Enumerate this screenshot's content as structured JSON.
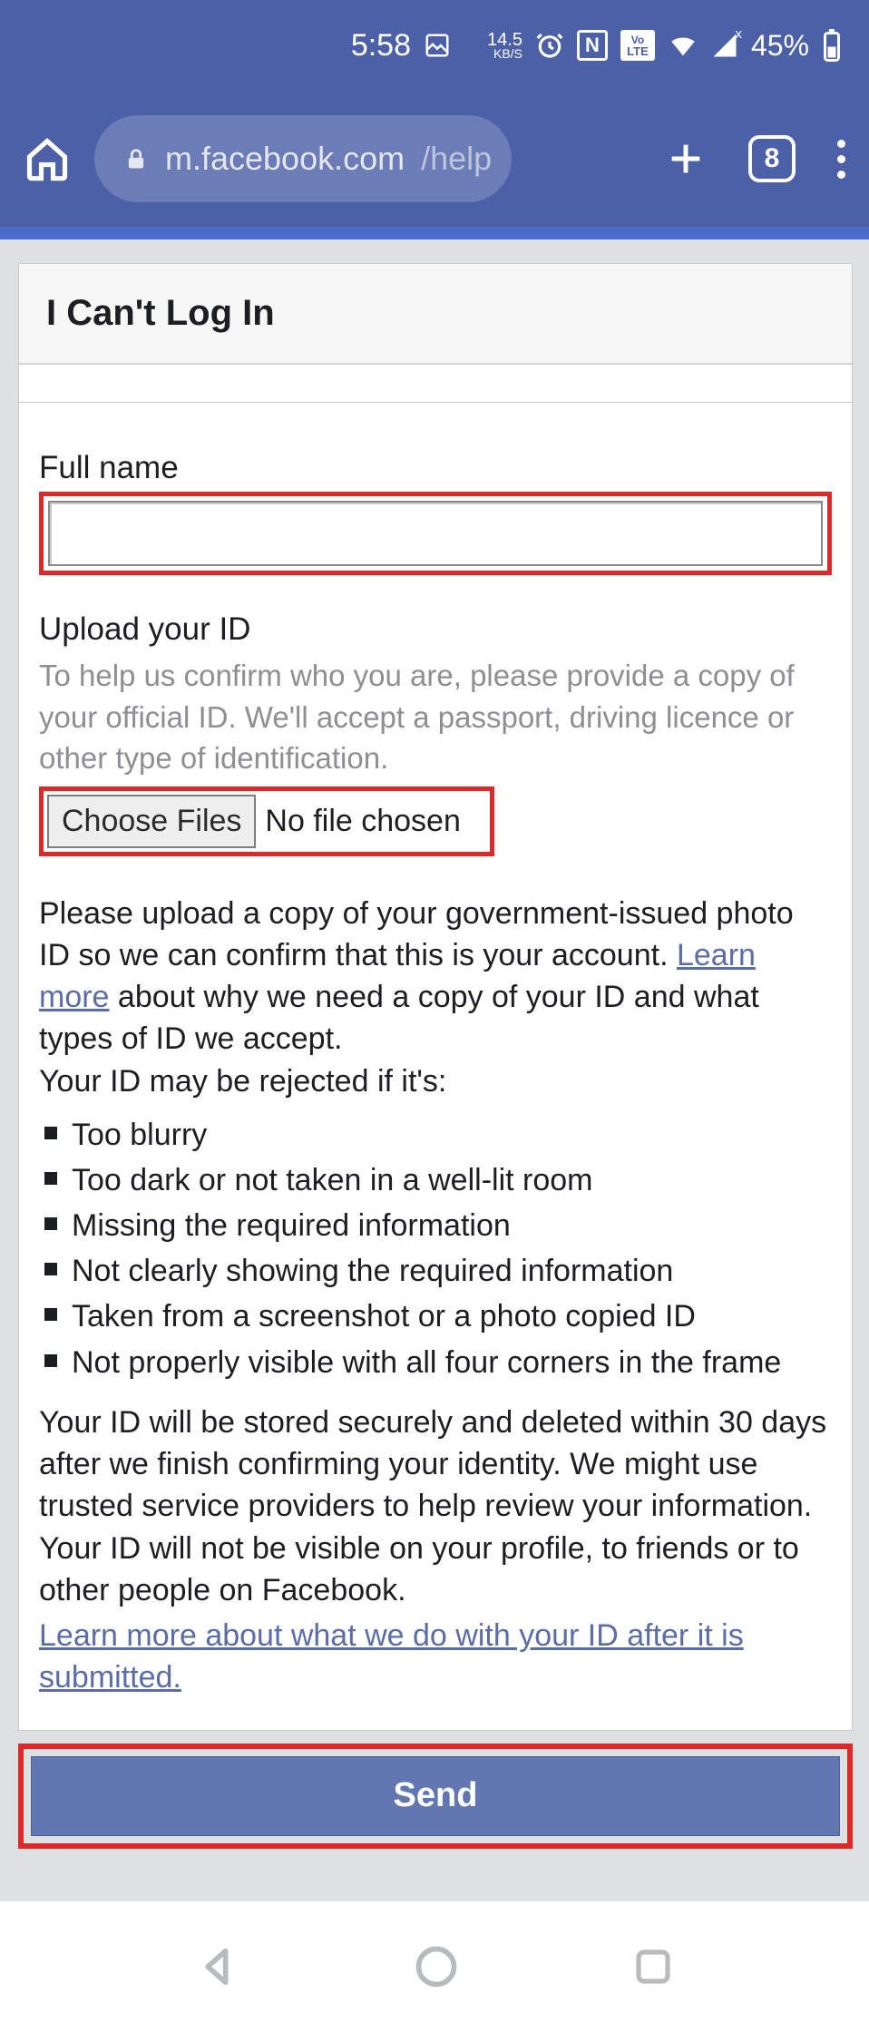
{
  "status": {
    "time": "5:58",
    "speed_top": "14.5",
    "speed_bottom": "KB/S",
    "network_badge": "Vo\nLTE",
    "battery": "45%"
  },
  "browser": {
    "url_host": "m.facebook.com",
    "url_path": "/help",
    "tab_count": "8"
  },
  "page": {
    "title": "I Can't Log In",
    "full_name_label": "Full name",
    "full_name_value": "",
    "upload_label": "Upload your ID",
    "upload_help": "To help us confirm who you are, please provide a copy of your official ID. We'll accept a passport, driving licence or other type of identification.",
    "choose_files": "Choose Files",
    "no_file": "No file chosen",
    "body_before_link": "Please upload a copy of your government-issued photo ID so we can confirm that this is your account. ",
    "learn_more": "Learn more",
    "body_after_link": " about why we need a copy of your ID and what types of ID we accept.",
    "criteria_heading": "Your ID may be rejected if it's:",
    "criteria": [
      "Too blurry",
      "Too dark or not taken in a well-lit room",
      "Missing the required information",
      "Not clearly showing the required information",
      "Taken from a screenshot or a photo copied ID",
      "Not properly visible with all four corners in the frame"
    ],
    "storage": "Your ID will be stored securely and deleted within 30 days after we finish confirming your identity. We might use trusted service providers to help review your information. Your ID will not be visible on your profile, to friends or to other people on Facebook.",
    "learn_more_2": "Learn more about what we do with your ID after it is submitted.",
    "send": "Send"
  }
}
